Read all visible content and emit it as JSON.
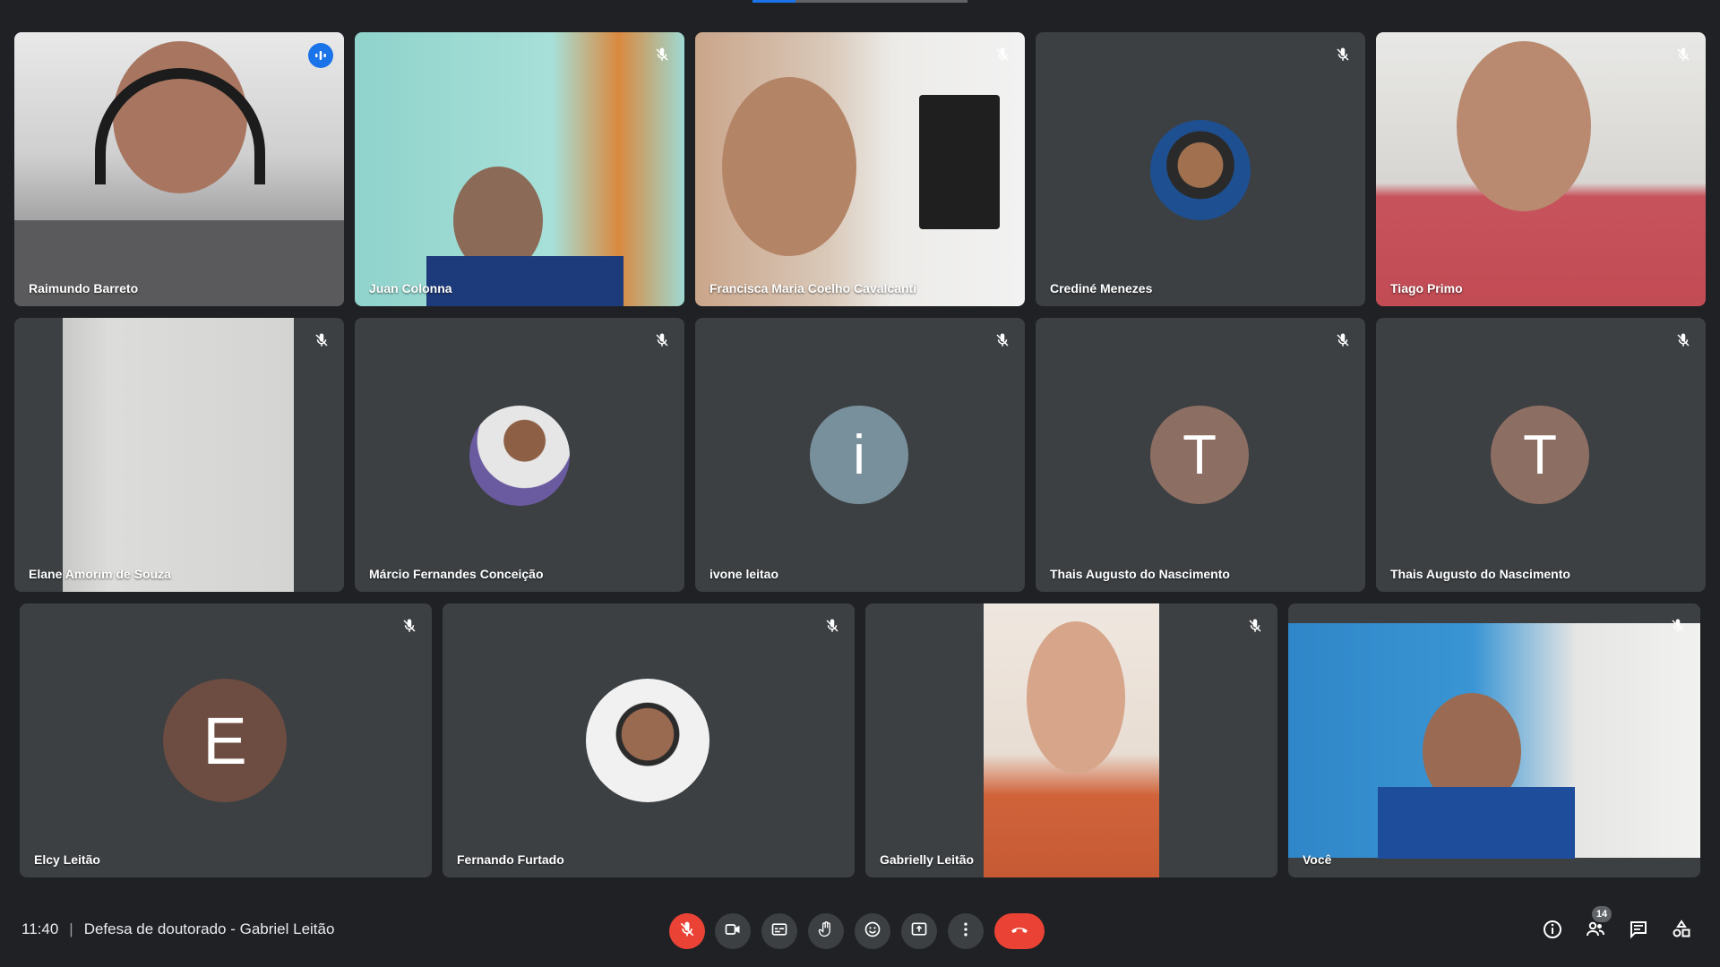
{
  "meeting": {
    "time": "11:40",
    "separator": "|",
    "title": "Defesa de doutorado - Gabriel Leitão"
  },
  "participants": [
    {
      "name": "Raimundo Barreto",
      "state": "speaking",
      "video": true
    },
    {
      "name": "Juan Colonna",
      "state": "muted",
      "video": true
    },
    {
      "name": "Francisca Maria Coelho Cavalcanti",
      "state": "muted",
      "video": true
    },
    {
      "name": "Crediné Menezes",
      "state": "muted",
      "video": false,
      "avatar": "photo"
    },
    {
      "name": "Tiago Primo",
      "state": "muted",
      "video": true
    },
    {
      "name": "Elane Amorim de Souza",
      "state": "muted",
      "video": true
    },
    {
      "name": "Márcio Fernandes Conceição",
      "state": "muted",
      "video": false,
      "avatar": "photo"
    },
    {
      "name": "ivone leitao",
      "state": "muted",
      "video": false,
      "avatar_letter": "i",
      "avatar_color": "#78909c"
    },
    {
      "name": "Thais Augusto do Nascimento",
      "state": "muted",
      "video": false,
      "avatar_letter": "T",
      "avatar_color": "#8d6e63"
    },
    {
      "name": "Thais Augusto do Nascimento",
      "state": "muted",
      "video": false,
      "avatar_letter": "T",
      "avatar_color": "#8d6e63"
    },
    {
      "name": "Elcy Leitão",
      "state": "muted",
      "video": false,
      "avatar_letter": "E",
      "avatar_color": "#6d4c41"
    },
    {
      "name": "Fernando Furtado",
      "state": "muted",
      "video": false,
      "avatar": "photo"
    },
    {
      "name": "Gabrielly Leitão",
      "state": "muted",
      "video": true
    },
    {
      "name": "Você",
      "state": "muted",
      "video": true
    }
  ],
  "controls": {
    "mic": "mic-off-icon",
    "camera": "videocam-icon",
    "captions": "closed-caption-icon",
    "raise_hand": "hand-icon",
    "reactions": "emoji-icon",
    "present": "present-screen-icon",
    "more": "more-vert-icon",
    "leave": "call-end-icon"
  },
  "right_panel": {
    "info": "info-icon",
    "people": "people-icon",
    "people_count": "14",
    "chat": "chat-icon",
    "activities": "activities-icon"
  },
  "colors": {
    "background": "#202124",
    "tile": "#3c4043",
    "red": "#ea4335",
    "speaking": "#1a73e8"
  }
}
